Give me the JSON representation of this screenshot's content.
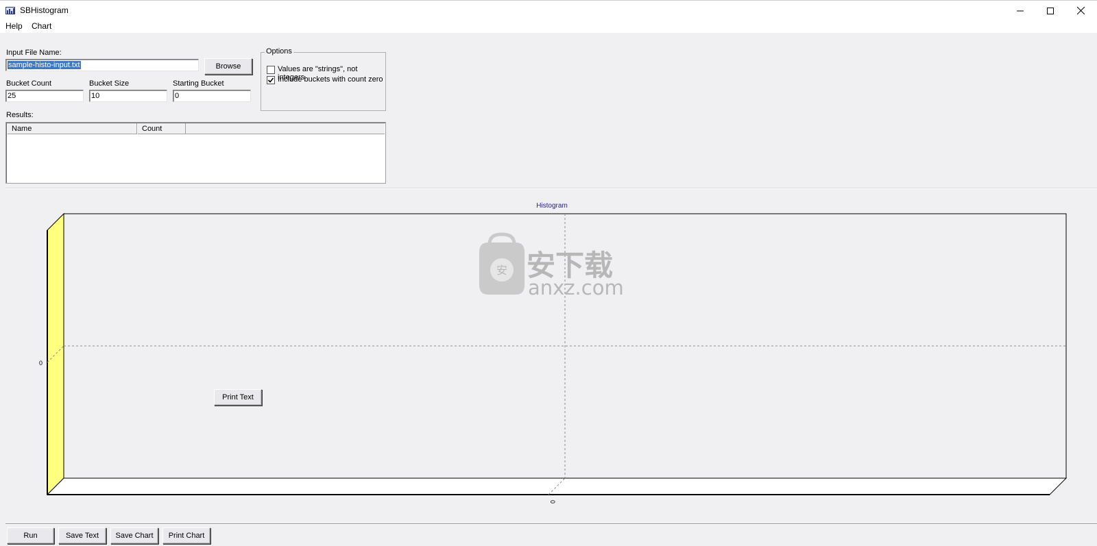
{
  "window": {
    "title": "SBHistogram"
  },
  "menu": [
    "Help",
    "Chart"
  ],
  "form": {
    "input_file_label": "Input File Name:",
    "input_file_value": "sample-histo-input.txt",
    "browse_label": "Browse",
    "bucket_count_label": "Bucket Count",
    "bucket_count_value": "25",
    "bucket_size_label": "Bucket Size",
    "bucket_size_value": "10",
    "starting_bucket_label": "Starting Bucket",
    "starting_bucket_value": "0"
  },
  "options": {
    "title": "Options",
    "items": [
      {
        "label": "Values are \"strings\", not integers",
        "checked": false
      },
      {
        "label": "Include buckets with count zero",
        "checked": true
      }
    ]
  },
  "results": {
    "label": "Results:",
    "columns": [
      "Name",
      "Count"
    ],
    "rows": []
  },
  "chart_data": {
    "type": "bar",
    "title": "Histogram",
    "categories": [
      "0"
    ],
    "values": [],
    "y_tick_labels": [
      "0"
    ],
    "x_tick_labels": [
      "0"
    ],
    "grid": true,
    "colors": {
      "wall": "#ffff80",
      "floor": "#ffffff",
      "title": "#2020a0"
    }
  },
  "chart_buttons": {
    "print_text": "Print Text"
  },
  "watermark": {
    "chinese": "安下载",
    "domain": "anxz.com",
    "badge": "安"
  },
  "bottom_buttons": {
    "run": "Run",
    "save_text": "Save Text",
    "save_chart": "Save Chart",
    "print_chart": "Print Chart"
  }
}
